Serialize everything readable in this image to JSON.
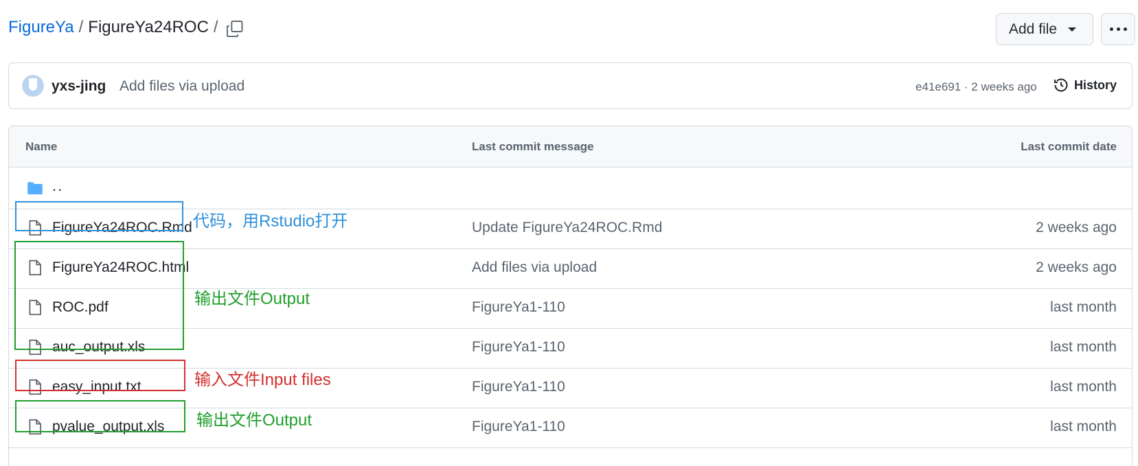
{
  "breadcrumb": {
    "owner": "FigureYa",
    "separator": "/",
    "repo": "FigureYa24ROC",
    "trailing_separator": "/"
  },
  "actions": {
    "add_file_label": "Add file",
    "more_label": "More options"
  },
  "latest_commit": {
    "author": "yxs-jing",
    "message": "Add files via upload",
    "hash_time": "e41e691 · 2 weeks ago",
    "history_label": "History"
  },
  "table": {
    "headers": {
      "name": "Name",
      "message": "Last commit message",
      "date": "Last commit date"
    },
    "parent_dir": "..",
    "rows": [
      {
        "name": "FigureYa24ROC.Rmd",
        "message": "Update FigureYa24ROC.Rmd",
        "date": "2 weeks ago"
      },
      {
        "name": "FigureYa24ROC.html",
        "message": "Add files via upload",
        "date": "2 weeks ago"
      },
      {
        "name": "ROC.pdf",
        "message": "FigureYa1-110",
        "date": "last month"
      },
      {
        "name": "auc_output.xls",
        "message": "FigureYa1-110",
        "date": "last month"
      },
      {
        "name": "easy_input.txt",
        "message": "FigureYa1-110",
        "date": "last month"
      },
      {
        "name": "pvalue_output.xls",
        "message": "FigureYa1-110",
        "date": "last month"
      }
    ]
  },
  "annotations": {
    "code_note": "代码，用Rstudio打开",
    "output_note": "输出文件Output",
    "input_note": "输入文件Input files",
    "output_note_2": "输出文件Output"
  },
  "colors": {
    "link": "#0969da",
    "folder": "#54aeff",
    "annotation_blue": "#2f8fd8",
    "annotation_green": "#1e9e2a",
    "annotation_red": "#d32f2f"
  }
}
